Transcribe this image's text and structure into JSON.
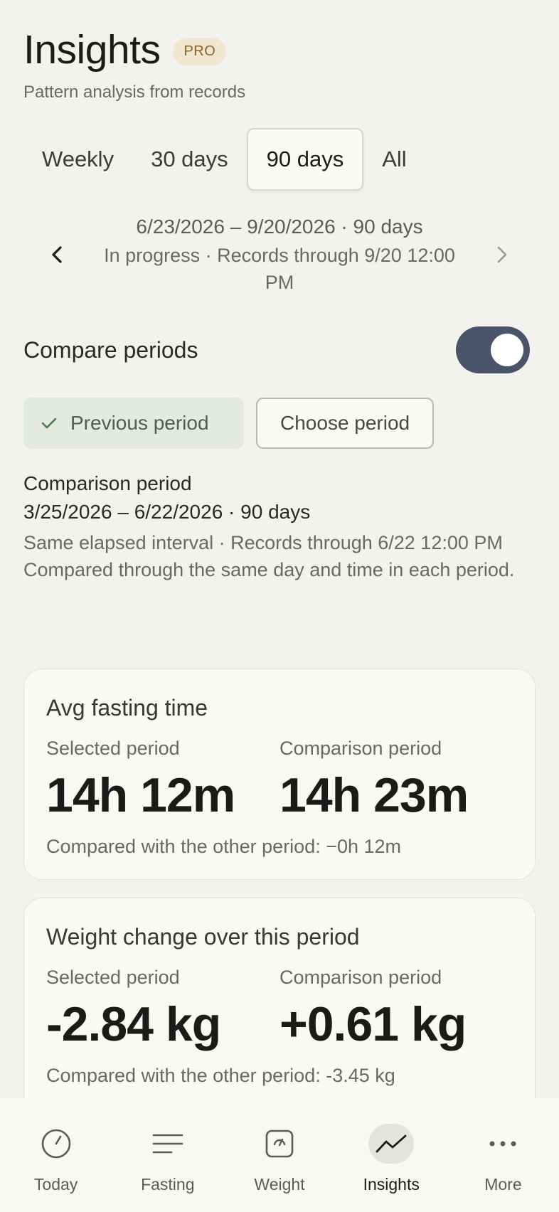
{
  "header": {
    "title": "Insights",
    "badge": "PRO",
    "subtitle": "Pattern analysis from records"
  },
  "tabs": [
    {
      "label": "Weekly",
      "active": false
    },
    {
      "label": "30 days",
      "active": false
    },
    {
      "label": "90 days",
      "active": true
    },
    {
      "label": "All",
      "active": false
    }
  ],
  "period": {
    "range": "6/23/2026 – 9/20/2026 · 90 days",
    "status": "In progress · Records through 9/20 12:00 PM"
  },
  "compare": {
    "label": "Compare periods",
    "enabled": true,
    "chip_previous": "Previous period",
    "chip_choose": "Choose period"
  },
  "comparison_info": {
    "label": "Comparison period",
    "range": "3/25/2026 – 6/22/2026 · 90 days",
    "note1": "Same elapsed interval · Records through 6/22 12:00 PM",
    "note2": "Compared through the same day and time in each period."
  },
  "cards": [
    {
      "title": "Avg fasting time",
      "selected_label": "Selected period",
      "selected_value": "14h 12m",
      "comparison_label": "Comparison period",
      "comparison_value": "14h 23m",
      "diff": "Compared with the other period: −0h 12m"
    },
    {
      "title": "Weight change over this period",
      "selected_label": "Selected period",
      "selected_value": "-2.84 kg",
      "comparison_label": "Comparison period",
      "comparison_value": "+0.61 kg",
      "diff": "Compared with the other period: -3.45 kg"
    }
  ],
  "bottom_nav": [
    {
      "label": "Today",
      "icon": "clock-icon",
      "active": false
    },
    {
      "label": "Fasting",
      "icon": "list-icon",
      "active": false
    },
    {
      "label": "Weight",
      "icon": "scale-icon",
      "active": false
    },
    {
      "label": "Insights",
      "icon": "trend-icon",
      "active": true
    },
    {
      "label": "More",
      "icon": "more-icon",
      "active": false
    }
  ],
  "colors": {
    "background": "#f3f2ef",
    "toggle_on": "#4a5468",
    "chip_selected": "#e4e9e1",
    "check": "#4d7a52",
    "pro_badge_bg": "#f1e6d0",
    "pro_badge_text": "#8c6428"
  }
}
